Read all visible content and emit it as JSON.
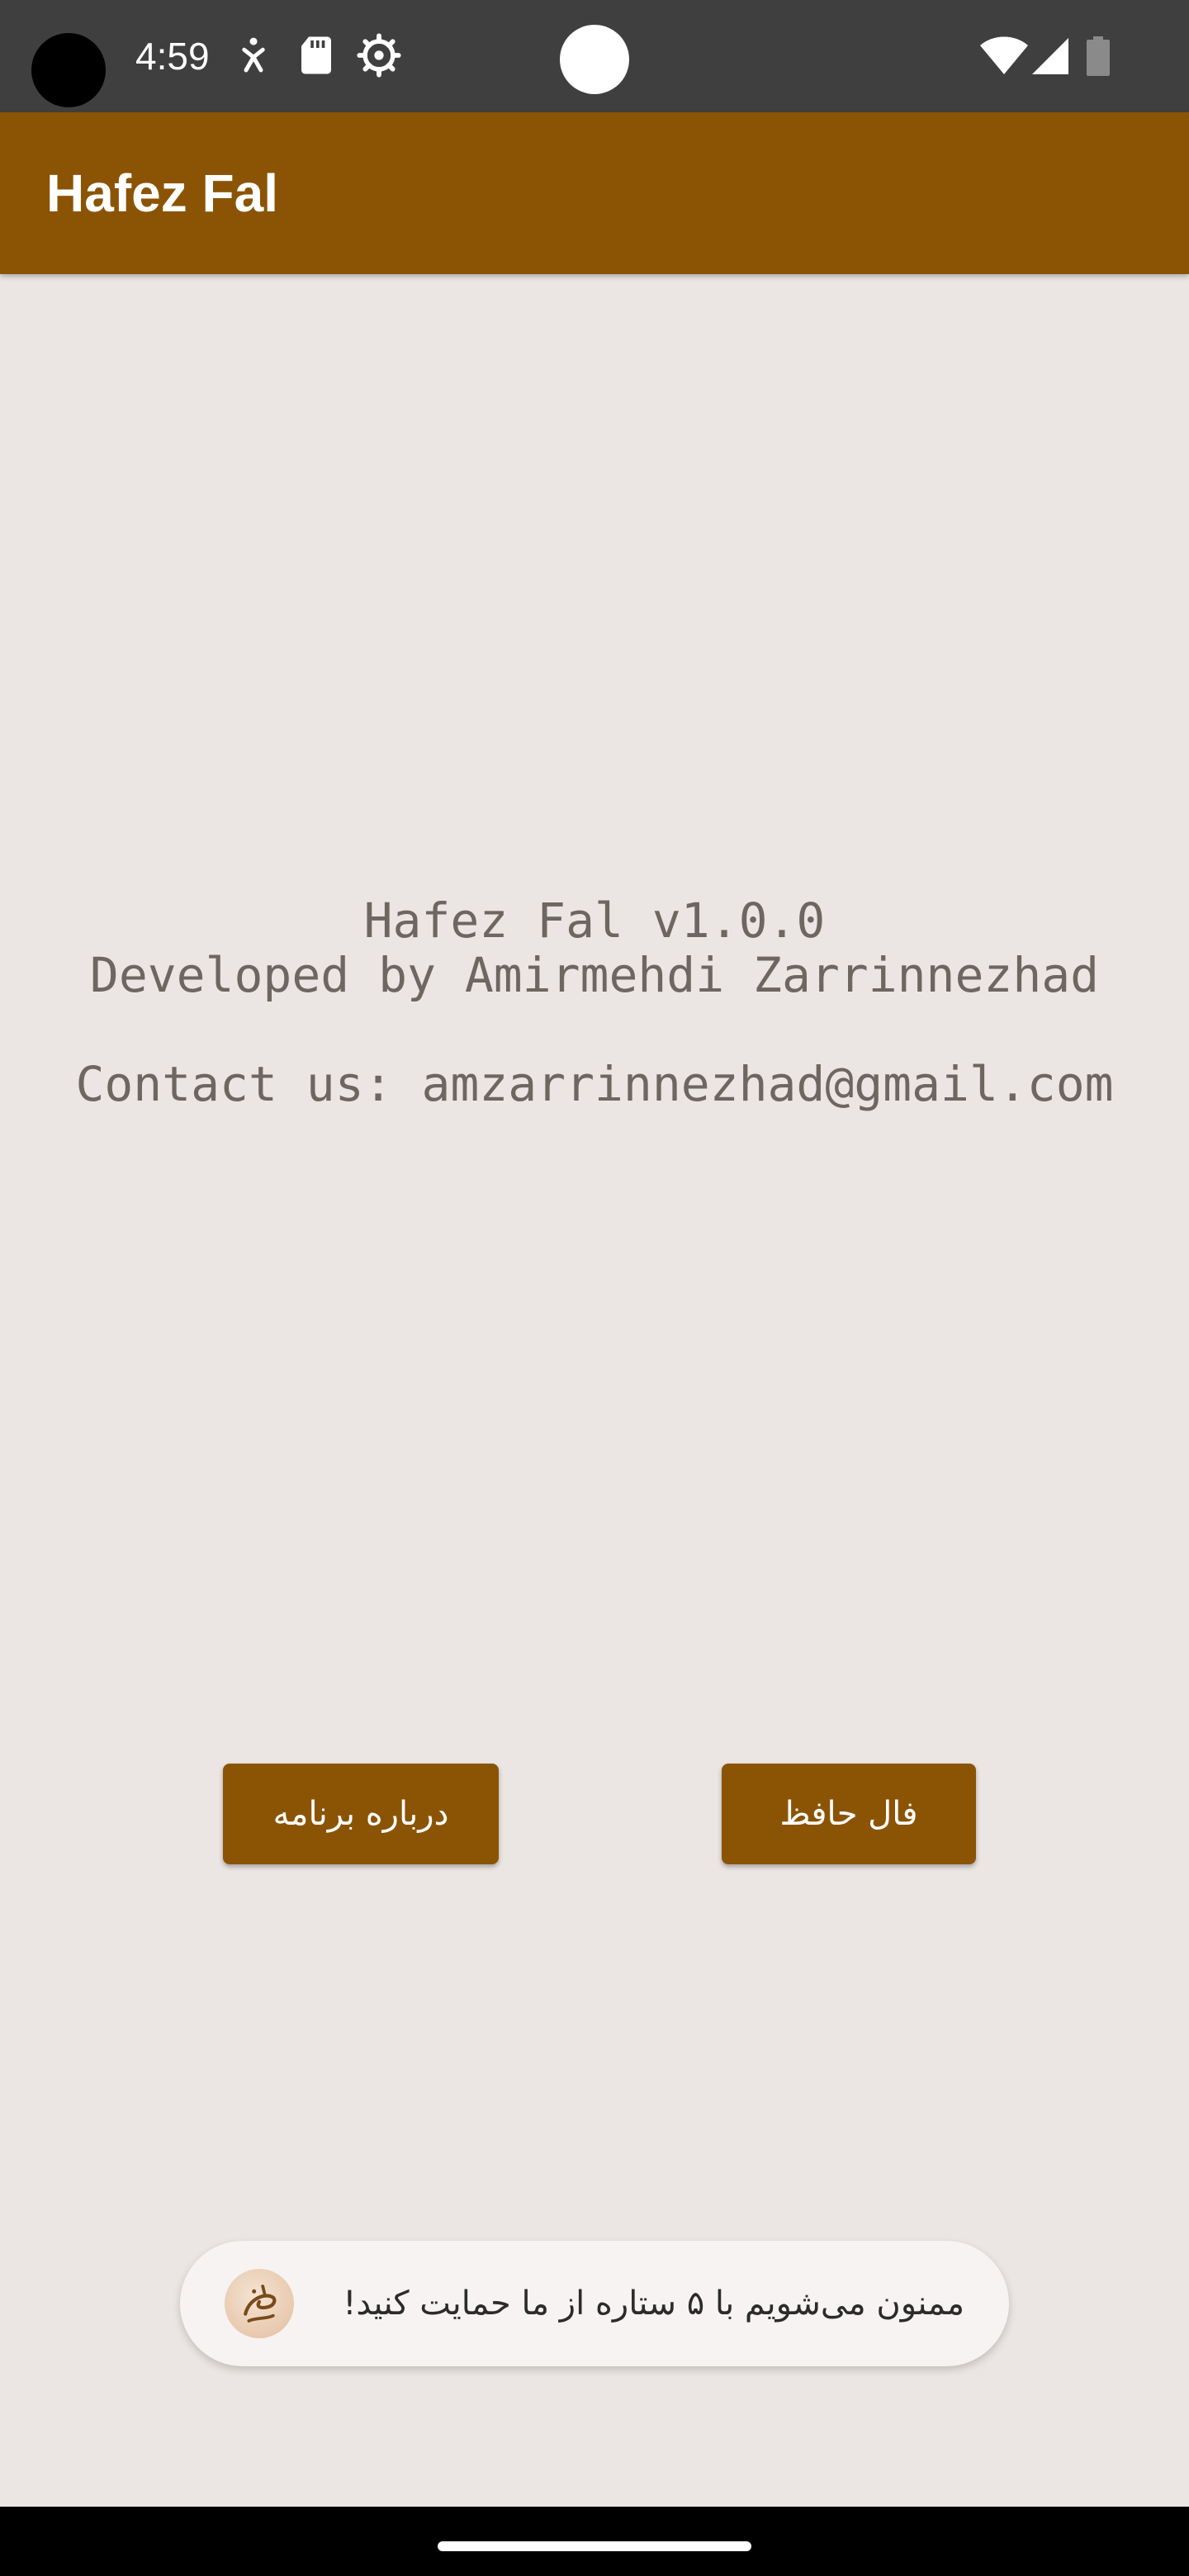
{
  "status_bar": {
    "time": "4:59",
    "icons": [
      "accessibility-icon",
      "sd-card-icon",
      "settings-icon",
      "wifi-icon",
      "signal-icon",
      "battery-icon"
    ]
  },
  "app_bar": {
    "title": "Hafez Fal"
  },
  "info": {
    "version_line": "Hafez Fal v1.0.0",
    "developer_line": "Developed by Amirmehdi Zarrinnezhad",
    "contact_line": "Contact us: amzarrinnezhad@gmail.com"
  },
  "buttons": {
    "about_label": "درباره برنامه",
    "fal_label": "فال حافظ"
  },
  "rating": {
    "text": "ممنون می‌شویم با ۵ ستاره از ما حمایت کنید!",
    "logo_icon": "hafez-logo-icon"
  },
  "colors": {
    "accent": "#8B5405",
    "background": "#EBE6E3",
    "status_bar": "#3F3F3F",
    "info_text": "#6E6661"
  }
}
